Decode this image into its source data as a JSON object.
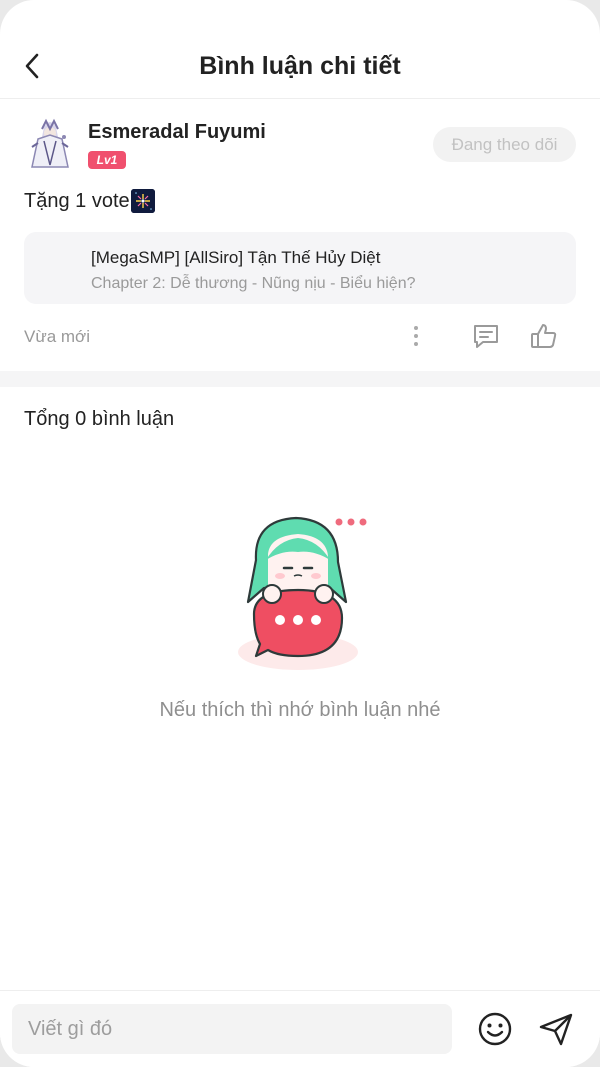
{
  "header": {
    "title": "Bình luận chi tiết",
    "back_icon": "chevron-left-icon"
  },
  "comment": {
    "username": "Esmeradal Fuyumi",
    "level": "Lv1",
    "follow_label": "Đang theo dõi",
    "text": "Tặng 1 vote",
    "vote_icon": "fireworks-emoji",
    "story": {
      "title": "[MegaSMP] [AllSiro] Tận Thế Hủy Diệt",
      "chapter": "Chapter 2: Dễ thương - Nũng nịu - Biểu hiện?"
    },
    "time": "Vừa mới",
    "actions": [
      "more-vertical-icon",
      "reply-icon",
      "like-icon"
    ]
  },
  "comments_section": {
    "total_label": "Tổng 0 bình luận",
    "empty_message": "Nếu thích thì nhớ bình luận nhé"
  },
  "input_bar": {
    "placeholder": "Viết gì đó",
    "emoji_icon": "smiley-icon",
    "send_icon": "send-icon"
  },
  "colors": {
    "accent": "#f0506e",
    "mascot_hair": "#5fdcb0",
    "muted_text": "#999999"
  }
}
